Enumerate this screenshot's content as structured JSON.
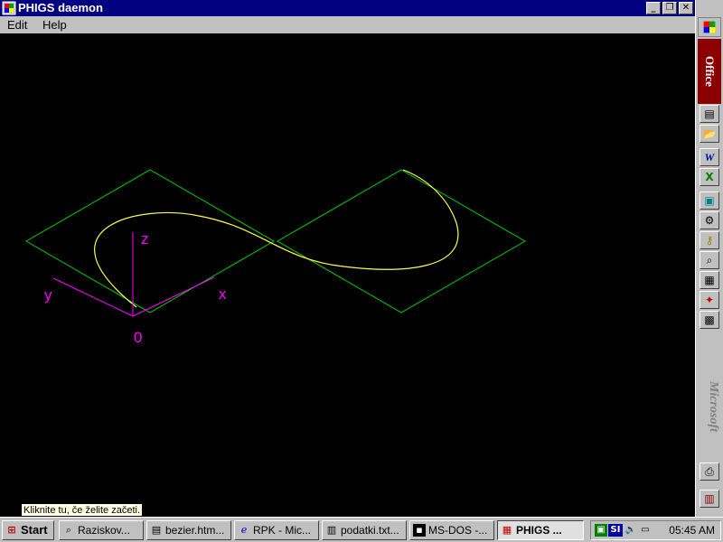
{
  "window": {
    "title": "PHIGS daemon",
    "minimize_glyph": "_",
    "restore_glyph": "❐",
    "close_glyph": "✕"
  },
  "menu": {
    "edit": "Edit",
    "help": "Help"
  },
  "scene": {
    "axis_z": "z",
    "axis_y": "y",
    "axis_x": "x",
    "origin": "0",
    "plane_color": "#00d000",
    "curve_color": "#ffff40",
    "axis_color": "#ff00ff"
  },
  "office": {
    "label": "Office",
    "vendor": "Microsoft"
  },
  "tooltip": "Kliknite tu, če želite začeti.",
  "taskbar": {
    "start": "Start",
    "tasks": [
      {
        "label": "Raziskov...",
        "icon": "explorer-icon"
      },
      {
        "label": "bezier.htm...",
        "icon": "document-icon"
      },
      {
        "label": "RPK - Mic...",
        "icon": "browser-icon"
      },
      {
        "label": "podatki.txt...",
        "icon": "notepad-icon"
      },
      {
        "label": "MS-DOS -...",
        "icon": "msdos-icon"
      },
      {
        "label": "PHIGS ...",
        "icon": "phigs-icon"
      }
    ],
    "tray_lang": "SI",
    "clock": "05:45 AM"
  }
}
